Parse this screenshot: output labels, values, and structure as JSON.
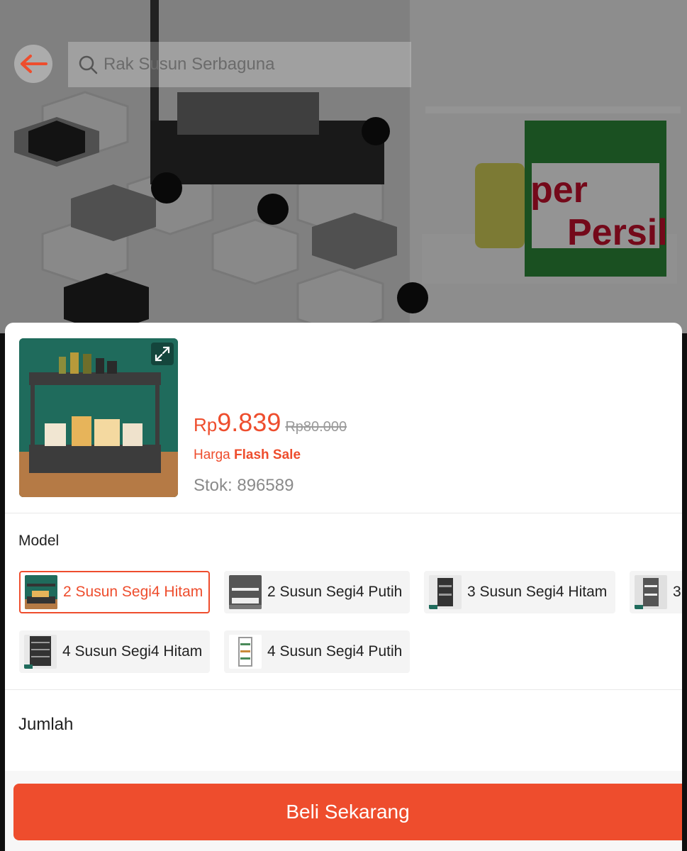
{
  "header": {
    "back_icon": "arrow-left-icon",
    "search_icon": "search-icon",
    "search_text": "Rak Susun Serbaguna"
  },
  "product": {
    "currency": "Rp",
    "price": "9.839",
    "original_price": "Rp80.000",
    "flash_prefix": "Harga ",
    "flash_bold": "Flash Sale",
    "stock": "Stok: 896589"
  },
  "model": {
    "label": "Model",
    "options": [
      {
        "label": "2 Susun Segi4 Hitam",
        "selected": true
      },
      {
        "label": "2 Susun Segi4 Putih",
        "selected": false
      },
      {
        "label": "3 Susun Segi4 Hitam",
        "selected": false
      },
      {
        "label": "3",
        "selected": false
      },
      {
        "label": "4 Susun Segi4 Hitam",
        "selected": false
      },
      {
        "label": "4 Susun Segi4 Putih",
        "selected": false
      }
    ]
  },
  "quantity": {
    "label": "Jumlah"
  },
  "actions": {
    "buy_label": "Beli Sekarang"
  },
  "colors": {
    "accent": "#ee4d2d"
  }
}
